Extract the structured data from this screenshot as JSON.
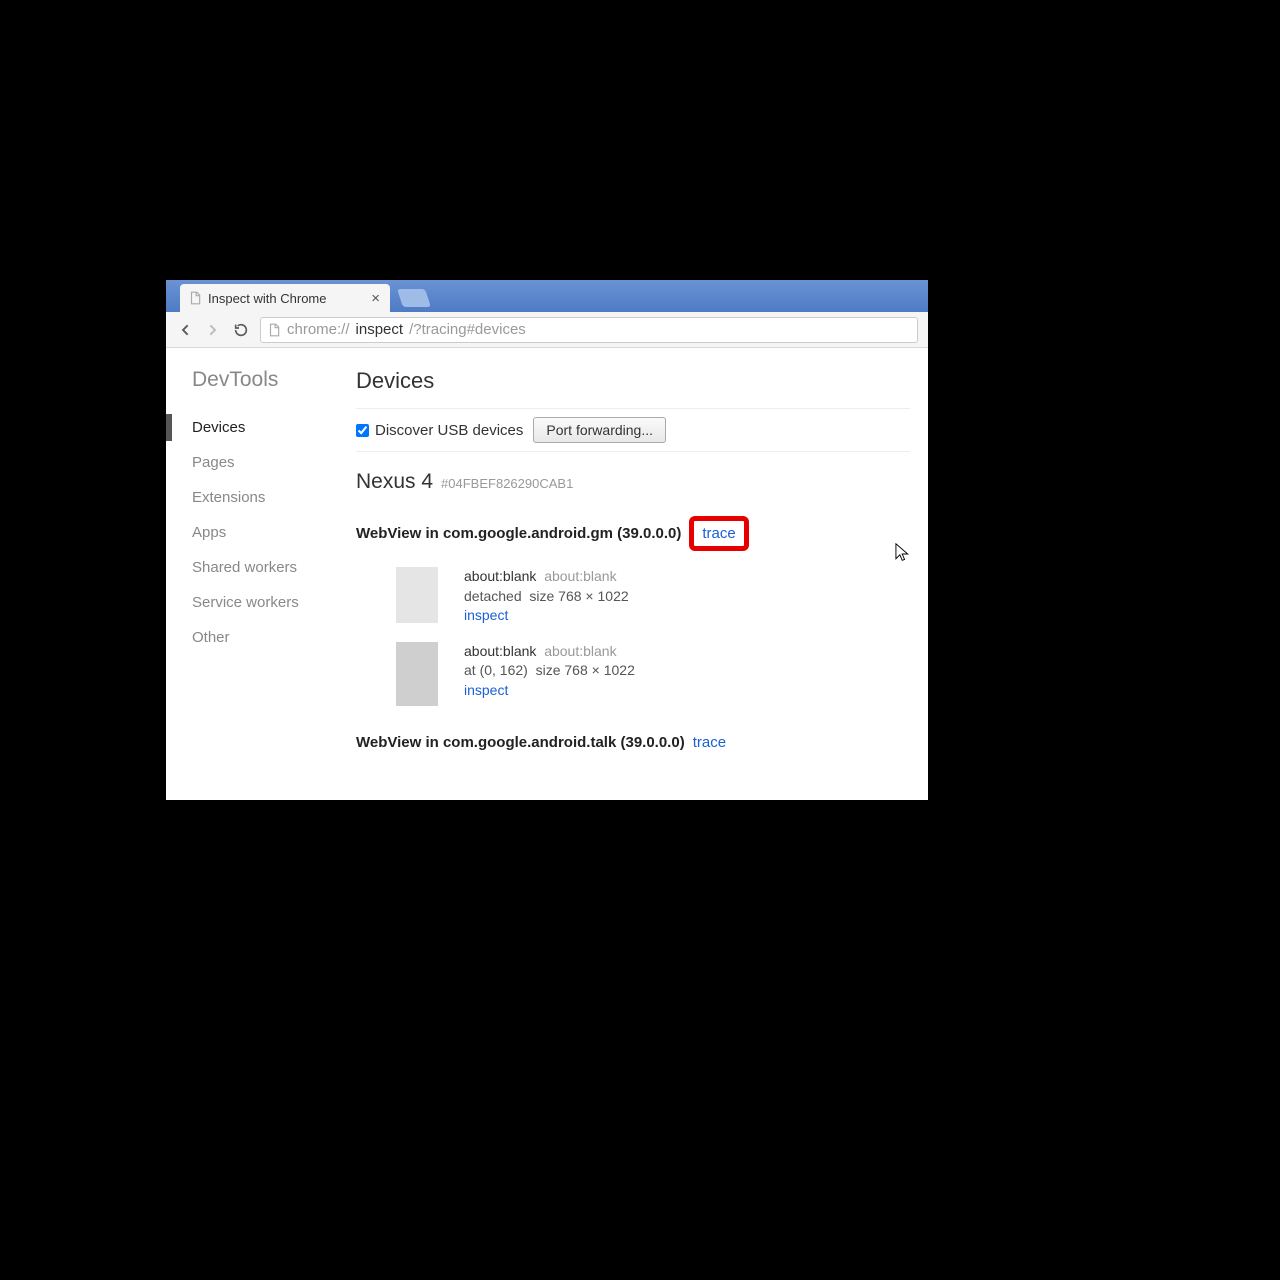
{
  "tab": {
    "title": "Inspect with Chrome"
  },
  "url": {
    "pre": "chrome://",
    "strong": "inspect",
    "post": "/?tracing#devices"
  },
  "sidebar": {
    "title": "DevTools",
    "items": [
      "Devices",
      "Pages",
      "Extensions",
      "Apps",
      "Shared workers",
      "Service workers",
      "Other"
    ]
  },
  "page": {
    "heading": "Devices",
    "discover_label": "Discover USB devices",
    "port_forwarding": "Port forwarding..."
  },
  "device": {
    "name": "Nexus 4",
    "serial": "#04FBEF826290CAB1"
  },
  "webviews": [
    {
      "title": "WebView in com.google.android.gm (39.0.0.0)",
      "trace": "trace",
      "highlighted": true,
      "pages": [
        {
          "name": "about:blank",
          "url": "about:blank",
          "pos": "detached",
          "size": "size 768 × 1022",
          "inspect": "inspect"
        },
        {
          "name": "about:blank",
          "url": "about:blank",
          "pos": "at (0, 162)",
          "size": "size 768 × 1022",
          "inspect": "inspect"
        }
      ]
    },
    {
      "title": "WebView in com.google.android.talk (39.0.0.0)",
      "trace": "trace",
      "highlighted": false,
      "pages": []
    }
  ]
}
